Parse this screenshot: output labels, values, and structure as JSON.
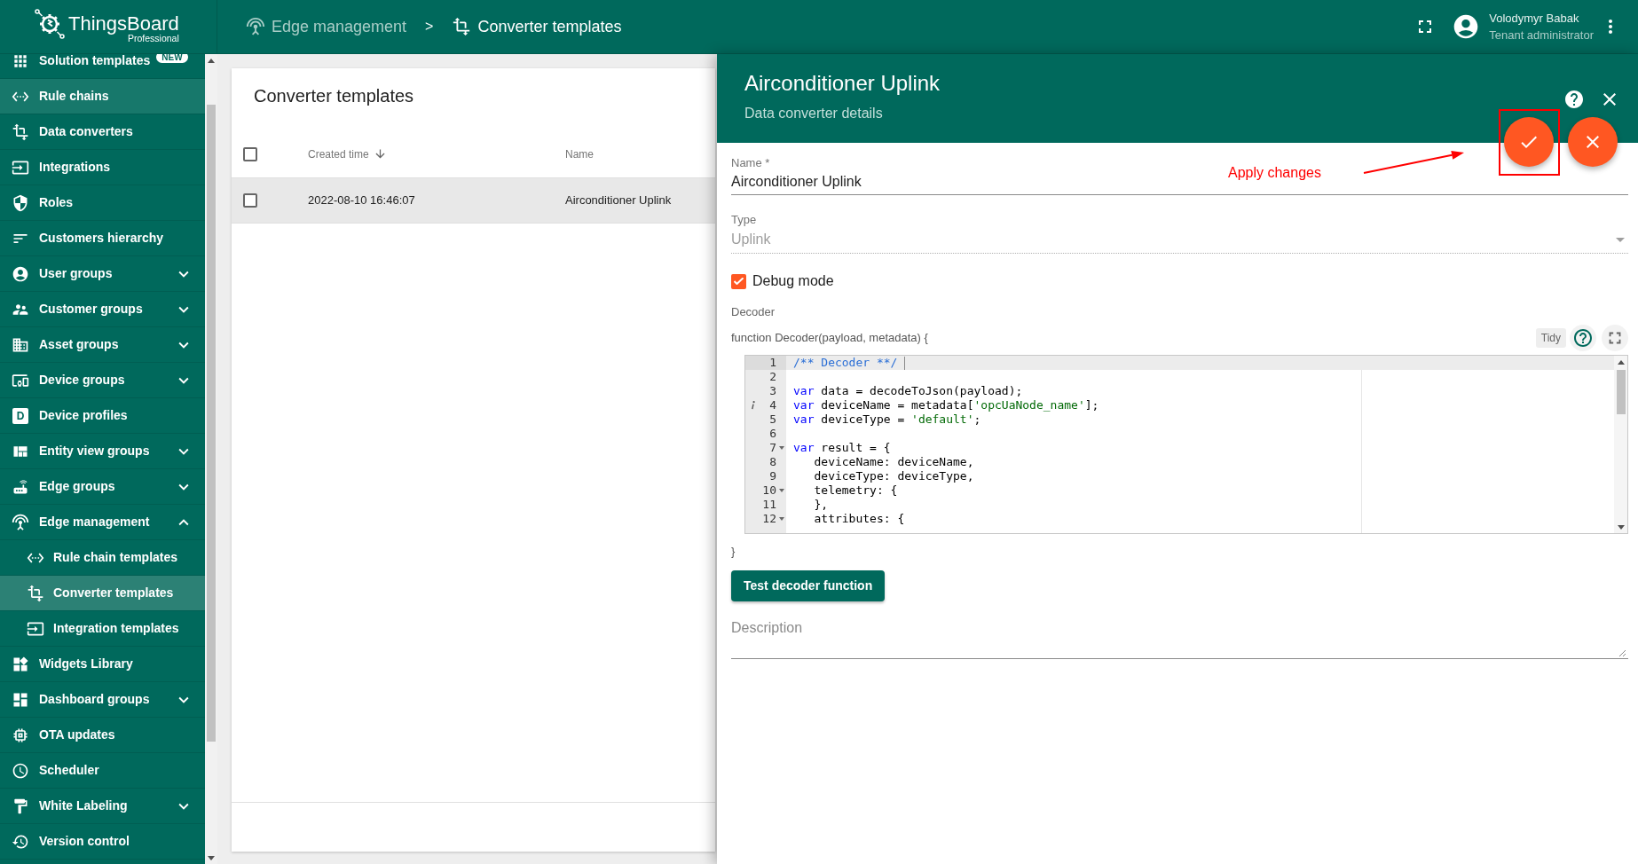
{
  "app": {
    "brand": "ThingsBoard",
    "edition": "Professional"
  },
  "breadcrumbs": {
    "separator": ">",
    "items": [
      {
        "label": "Edge management",
        "current": false
      },
      {
        "label": "Converter templates",
        "current": true
      }
    ]
  },
  "user": {
    "name": "Volodymyr Babak",
    "role": "Tenant administrator"
  },
  "sidebar": {
    "items": [
      {
        "label": "Solution templates",
        "kind": "link",
        "badge": "NEW",
        "selected": false,
        "hovered": false
      },
      {
        "label": "Rule chains",
        "kind": "link",
        "selected": false,
        "hovered": true
      },
      {
        "label": "Data converters",
        "kind": "link",
        "selected": false,
        "hovered": false
      },
      {
        "label": "Integrations",
        "kind": "link",
        "selected": false,
        "hovered": false
      },
      {
        "label": "Roles",
        "kind": "link",
        "selected": false,
        "hovered": false
      },
      {
        "label": "Customers hierarchy",
        "kind": "link",
        "selected": false,
        "hovered": false
      },
      {
        "label": "User groups",
        "kind": "group",
        "expanded": false,
        "selected": false,
        "hovered": false
      },
      {
        "label": "Customer groups",
        "kind": "group",
        "expanded": false,
        "selected": false,
        "hovered": false
      },
      {
        "label": "Asset groups",
        "kind": "group",
        "expanded": false,
        "selected": false,
        "hovered": false
      },
      {
        "label": "Device groups",
        "kind": "group",
        "expanded": false,
        "selected": false,
        "hovered": false
      },
      {
        "label": "Device profiles",
        "kind": "link",
        "icon_text": "D",
        "selected": false,
        "hovered": false
      },
      {
        "label": "Entity view groups",
        "kind": "group",
        "expanded": false,
        "selected": false,
        "hovered": false
      },
      {
        "label": "Edge groups",
        "kind": "group",
        "expanded": false,
        "selected": false,
        "hovered": false
      },
      {
        "label": "Edge management",
        "kind": "group",
        "expanded": true,
        "selected": false,
        "hovered": false,
        "children": [
          {
            "label": "Rule chain templates",
            "kind": "link",
            "selected": false,
            "hovered": false
          },
          {
            "label": "Converter templates",
            "kind": "link",
            "selected": true,
            "hovered": false
          },
          {
            "label": "Integration templates",
            "kind": "link",
            "selected": false,
            "hovered": false
          }
        ]
      },
      {
        "label": "Widgets Library",
        "kind": "link",
        "selected": false,
        "hovered": false
      },
      {
        "label": "Dashboard groups",
        "kind": "group",
        "expanded": false,
        "selected": false,
        "hovered": false
      },
      {
        "label": "OTA updates",
        "kind": "link",
        "selected": false,
        "hovered": false
      },
      {
        "label": "Scheduler",
        "kind": "link",
        "selected": false,
        "hovered": false
      },
      {
        "label": "White Labeling",
        "kind": "group",
        "expanded": false,
        "selected": false,
        "hovered": false
      },
      {
        "label": "Version control",
        "kind": "link",
        "selected": false,
        "hovered": false
      }
    ]
  },
  "table": {
    "title": "Converter templates",
    "all_checked": false,
    "columns": [
      {
        "label": "Created time",
        "sorted": true
      },
      {
        "label": "Name",
        "sorted": false
      }
    ],
    "rows": [
      {
        "cells": [
          "2022-08-10 16:46:07",
          "Airconditioner Uplink"
        ],
        "selected": true,
        "checked": false
      }
    ]
  },
  "details": {
    "title": "Airconditioner Uplink",
    "subtitle": "Data converter details",
    "name": {
      "label": "Name *",
      "value": "Airconditioner Uplink"
    },
    "type": {
      "label": "Type",
      "value": "Uplink",
      "disabled": true
    },
    "debug_mode": {
      "label": "Debug mode",
      "checked": true
    },
    "decoder": {
      "label": "Decoder",
      "signature": "function Decoder(payload, metadata) {",
      "tidy": "Tidy",
      "closing": "}",
      "lines": [
        {
          "number": "1",
          "active": true,
          "foldable": false,
          "info": false,
          "tokens": [
            {
              "kind": "comment",
              "text": "/** Decoder **/"
            }
          ]
        },
        {
          "number": "2",
          "active": false,
          "foldable": false,
          "info": false
        },
        {
          "number": "3",
          "active": false,
          "foldable": false,
          "info": false,
          "tokens": [
            {
              "kind": "keyword",
              "text": "var"
            },
            {
              "kind": "plain",
              "text": " data = decodeToJson(payload);"
            }
          ]
        },
        {
          "number": "4",
          "active": false,
          "foldable": false,
          "info": true,
          "tokens": [
            {
              "kind": "keyword",
              "text": "var"
            },
            {
              "kind": "plain",
              "text": " deviceName = metadata["
            },
            {
              "kind": "string",
              "text": "'opcUaNode_name'"
            },
            {
              "kind": "plain",
              "text": "];"
            }
          ]
        },
        {
          "number": "5",
          "active": false,
          "foldable": false,
          "info": false,
          "tokens": [
            {
              "kind": "keyword",
              "text": "var"
            },
            {
              "kind": "plain",
              "text": " deviceType = "
            },
            {
              "kind": "string",
              "text": "'default'"
            },
            {
              "kind": "plain",
              "text": ";"
            }
          ]
        },
        {
          "number": "6",
          "active": false,
          "foldable": false,
          "info": false
        },
        {
          "number": "7",
          "active": false,
          "foldable": true,
          "info": false,
          "tokens": [
            {
              "kind": "keyword",
              "text": "var"
            },
            {
              "kind": "plain",
              "text": " result = {"
            }
          ]
        },
        {
          "number": "8",
          "active": false,
          "foldable": false,
          "info": false,
          "tokens": [
            {
              "kind": "plain",
              "text": "   deviceName: deviceName,"
            }
          ]
        },
        {
          "number": "9",
          "active": false,
          "foldable": false,
          "info": false,
          "tokens": [
            {
              "kind": "plain",
              "text": "   deviceType: deviceType,"
            }
          ]
        },
        {
          "number": "10",
          "active": false,
          "foldable": true,
          "info": false,
          "tokens": [
            {
              "kind": "plain",
              "text": "   telemetry: {"
            }
          ]
        },
        {
          "number": "11",
          "active": false,
          "foldable": false,
          "info": false,
          "tokens": [
            {
              "kind": "plain",
              "text": "   },"
            }
          ]
        },
        {
          "number": "12",
          "active": false,
          "foldable": true,
          "info": false,
          "tokens": [
            {
              "kind": "plain",
              "text": "   attributes: {"
            }
          ]
        }
      ]
    },
    "test_button": "Test decoder function",
    "description": {
      "placeholder": "Description"
    }
  },
  "callout": {
    "text": "Apply changes"
  }
}
